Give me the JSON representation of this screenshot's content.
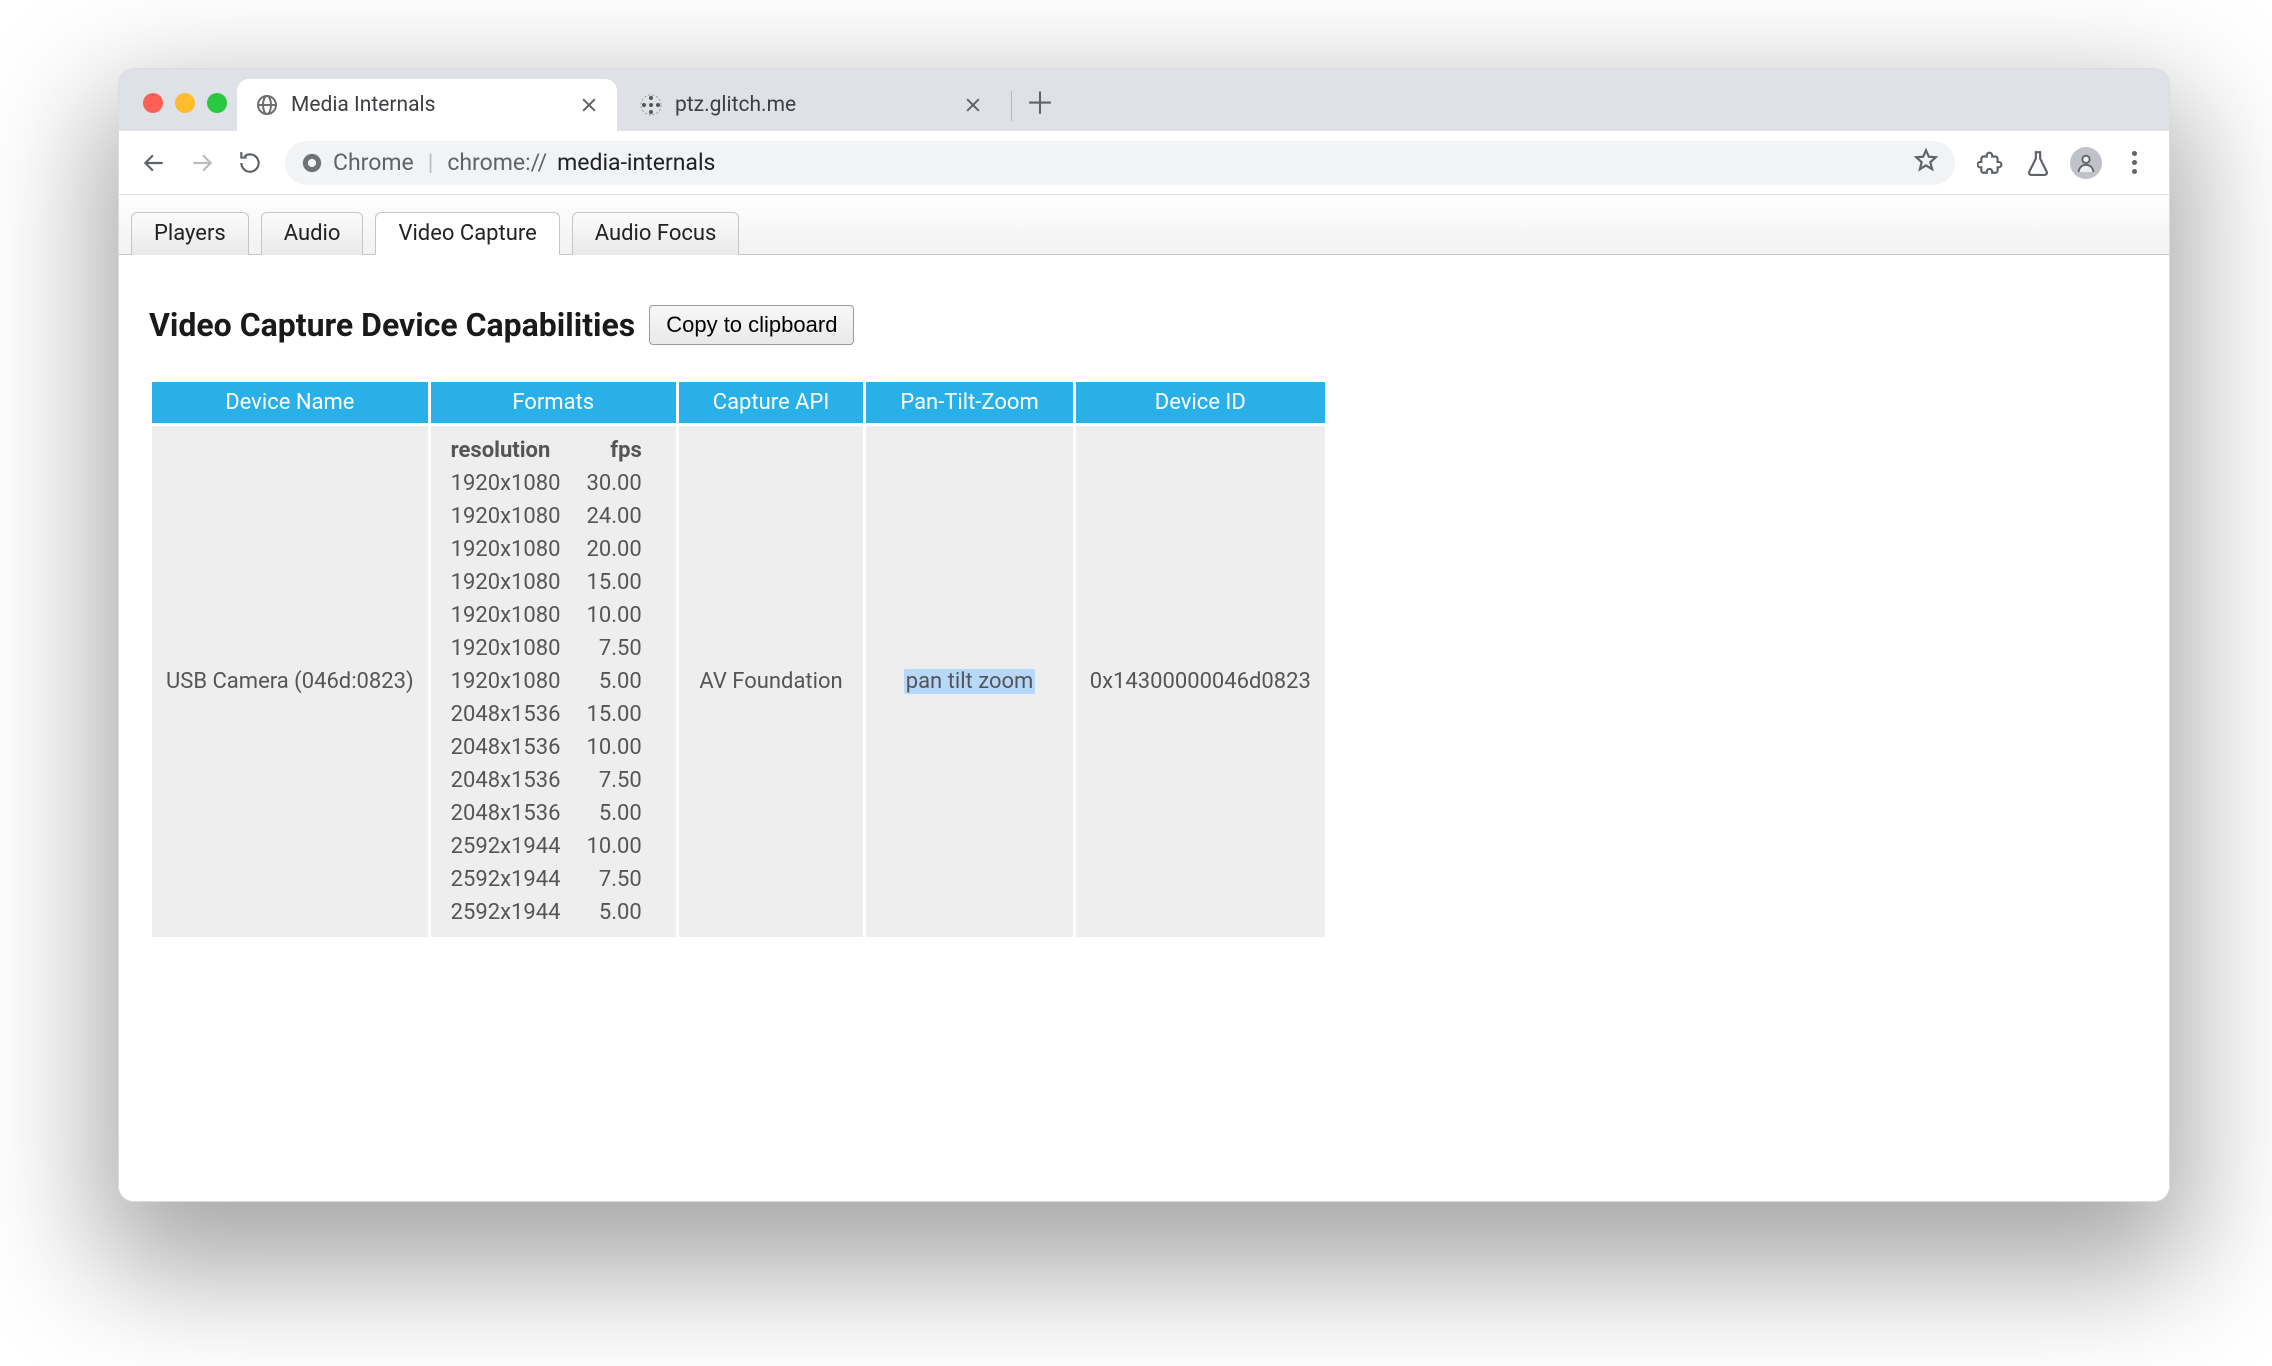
{
  "browser": {
    "tabs": [
      {
        "title": "Media Internals",
        "active": true
      },
      {
        "title": "ptz.glitch.me",
        "active": false
      }
    ],
    "omnibox": {
      "secure_label": "Chrome",
      "url_prefix": "chrome://",
      "url_path": "media-internals"
    }
  },
  "page": {
    "tabs": [
      "Players",
      "Audio",
      "Video Capture",
      "Audio Focus"
    ],
    "active_tab": "Video Capture",
    "heading": "Video Capture Device Capabilities",
    "copy_button": "Copy to clipboard",
    "table": {
      "headers": [
        "Device Name",
        "Formats",
        "Capture API",
        "Pan-Tilt-Zoom",
        "Device ID"
      ],
      "formats_headers": [
        "resolution",
        "fps"
      ],
      "rows": [
        {
          "device_name": "USB Camera (046d:0823)",
          "capture_api": "AV Foundation",
          "ptz": "pan tilt zoom",
          "device_id": "0x14300000046d0823",
          "formats": [
            {
              "res": "1920x1080",
              "fps": "30.00"
            },
            {
              "res": "1920x1080",
              "fps": "24.00"
            },
            {
              "res": "1920x1080",
              "fps": "20.00"
            },
            {
              "res": "1920x1080",
              "fps": "15.00"
            },
            {
              "res": "1920x1080",
              "fps": "10.00"
            },
            {
              "res": "1920x1080",
              "fps": "7.50"
            },
            {
              "res": "1920x1080",
              "fps": "5.00"
            },
            {
              "res": "2048x1536",
              "fps": "15.00"
            },
            {
              "res": "2048x1536",
              "fps": "10.00"
            },
            {
              "res": "2048x1536",
              "fps": "7.50"
            },
            {
              "res": "2048x1536",
              "fps": "5.00"
            },
            {
              "res": "2592x1944",
              "fps": "10.00"
            },
            {
              "res": "2592x1944",
              "fps": "7.50"
            },
            {
              "res": "2592x1944",
              "fps": "5.00"
            }
          ]
        }
      ]
    }
  }
}
